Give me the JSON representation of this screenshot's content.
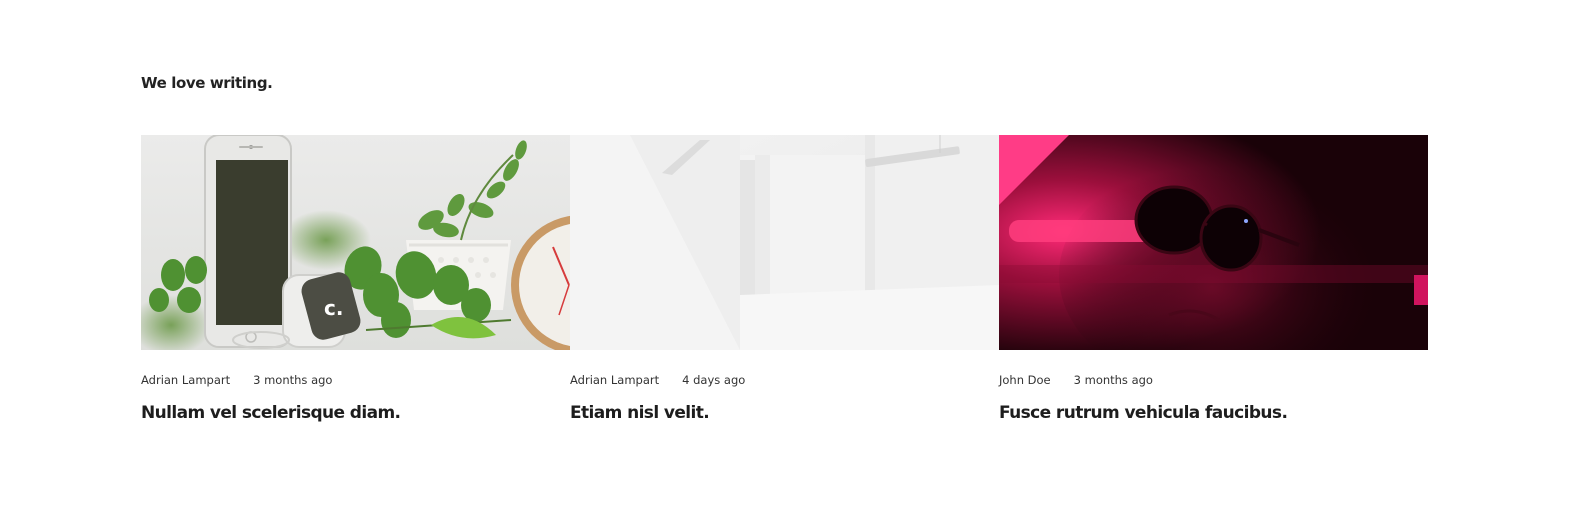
{
  "section": {
    "heading": "We love writing."
  },
  "posts": [
    {
      "author": "Adrian Lampart",
      "date": "3 months ago",
      "title": "Nullam vel scelerisque diam.",
      "image_icon": "phone-watch-plants-photo",
      "watch_logo": "c."
    },
    {
      "author": "Adrian Lampart",
      "date": "4 days ago",
      "title": "Etiam nisl velit.",
      "image_icon": "white-room-photo"
    },
    {
      "author": "John Doe",
      "date": "3 months ago",
      "title": "Fusce rutrum vehicula faucibus.",
      "image_icon": "neon-sunglasses-portrait-photo"
    }
  ],
  "colors": {
    "text": "#1d1d1d",
    "meta": "#333333",
    "neon": "#e0195a"
  }
}
